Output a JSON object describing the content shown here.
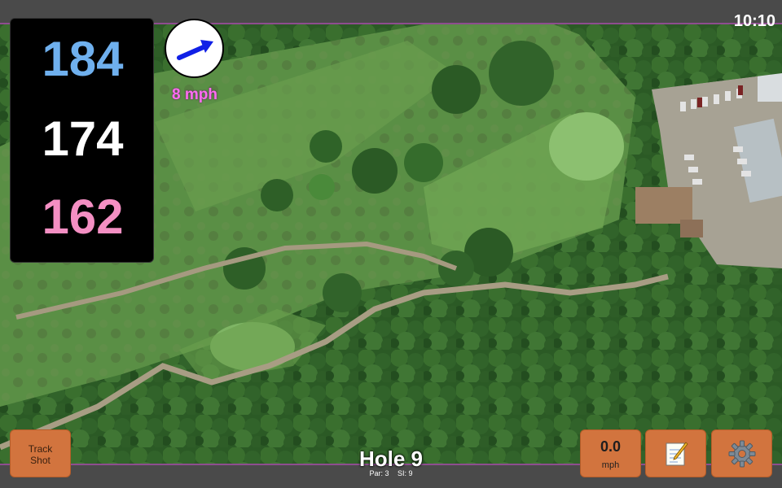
{
  "status": {
    "time": "10:10"
  },
  "distances": {
    "back": "184",
    "middle": "174",
    "front": "162"
  },
  "wind": {
    "speed": "8 mph",
    "direction_icon": "wind-arrow-icon"
  },
  "buttons": {
    "track_shot_line1": "Track",
    "track_shot_line2": "Shot",
    "speed_value": "0.0",
    "speed_unit": "mph",
    "notes_icon": "notepad-icon",
    "settings_icon": "gear-icon"
  },
  "hole": {
    "title": "Hole 9",
    "par": "Par: 3",
    "si": "SI: 9"
  },
  "colors": {
    "back_distance": "#6fb0ee",
    "middle_distance": "#ffffff",
    "front_distance": "#f48fc3",
    "button": "#d2743e",
    "accent_border": "#8e4d8f",
    "wind_text": "#ff6df1"
  }
}
